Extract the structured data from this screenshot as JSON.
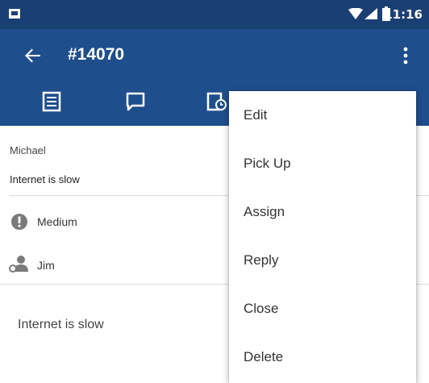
{
  "status_bar": {
    "time": "11:16",
    "icons": [
      "notification-icon",
      "wifi-icon",
      "signal-icon",
      "battery-icon"
    ]
  },
  "app_bar": {
    "title": "#14070",
    "back_icon": "arrow-left-icon",
    "overflow_icon": "more-vert-icon"
  },
  "tabs": [
    {
      "icon": "details-icon"
    },
    {
      "icon": "conversation-icon"
    },
    {
      "icon": "history-icon"
    }
  ],
  "ticket": {
    "requester": "Michael",
    "subject": "Internet is slow",
    "priority": "Medium",
    "agent": "Jim",
    "description": "Internet is slow"
  },
  "menu": {
    "items": [
      {
        "label": "Edit"
      },
      {
        "label": "Pick Up"
      },
      {
        "label": "Assign"
      },
      {
        "label": "Reply"
      },
      {
        "label": "Close"
      },
      {
        "label": "Delete"
      }
    ]
  },
  "colors": {
    "status_bar": "#1a3f73",
    "app_bar": "#1f4e8c",
    "priority_icon": "#7a7a7a",
    "text": "#333333"
  }
}
